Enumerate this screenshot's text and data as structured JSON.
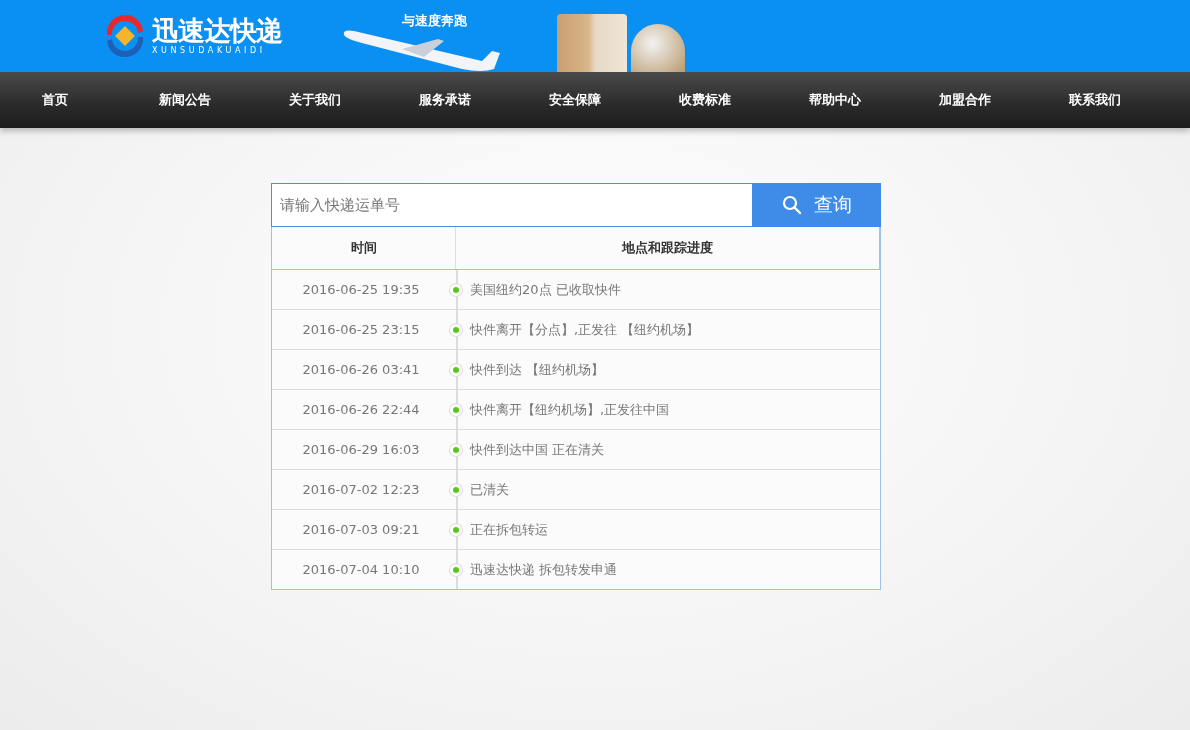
{
  "header": {
    "logo_text": "迅速达快递",
    "logo_subtext": "XUNSUDAKUAIDI",
    "slogan": "与速度奔跑"
  },
  "nav": [
    {
      "label": "首页"
    },
    {
      "label": "新闻公告"
    },
    {
      "label": "关于我们"
    },
    {
      "label": "服务承诺"
    },
    {
      "label": "安全保障"
    },
    {
      "label": "收费标准"
    },
    {
      "label": "帮助中心"
    },
    {
      "label": "加盟合作"
    },
    {
      "label": "联系我们"
    }
  ],
  "search": {
    "placeholder": "请输入快递运单号",
    "button": "查询"
  },
  "table": {
    "columns": [
      "时间",
      "地点和跟踪进度"
    ],
    "rows": [
      {
        "time": "2016-06-25 19:35",
        "status": "美国纽约20点 已收取快件"
      },
      {
        "time": "2016-06-25 23:15",
        "status": "快件离开【分点】,正发往 【纽约机场】"
      },
      {
        "time": "2016-06-26 03:41",
        "status": "快件到达 【纽约机场】"
      },
      {
        "time": "2016-06-26 22:44",
        "status": "快件离开【纽约机场】,正发往中国"
      },
      {
        "time": "2016-06-29 16:03",
        "status": "快件到达中国 正在清关"
      },
      {
        "time": "2016-07-02 12:23",
        "status": "已清关"
      },
      {
        "time": "2016-07-03 09:21",
        "status": "正在拆包转运"
      },
      {
        "time": "2016-07-04 10:10",
        "status": "迅速达快递 拆包转发申通"
      }
    ]
  }
}
